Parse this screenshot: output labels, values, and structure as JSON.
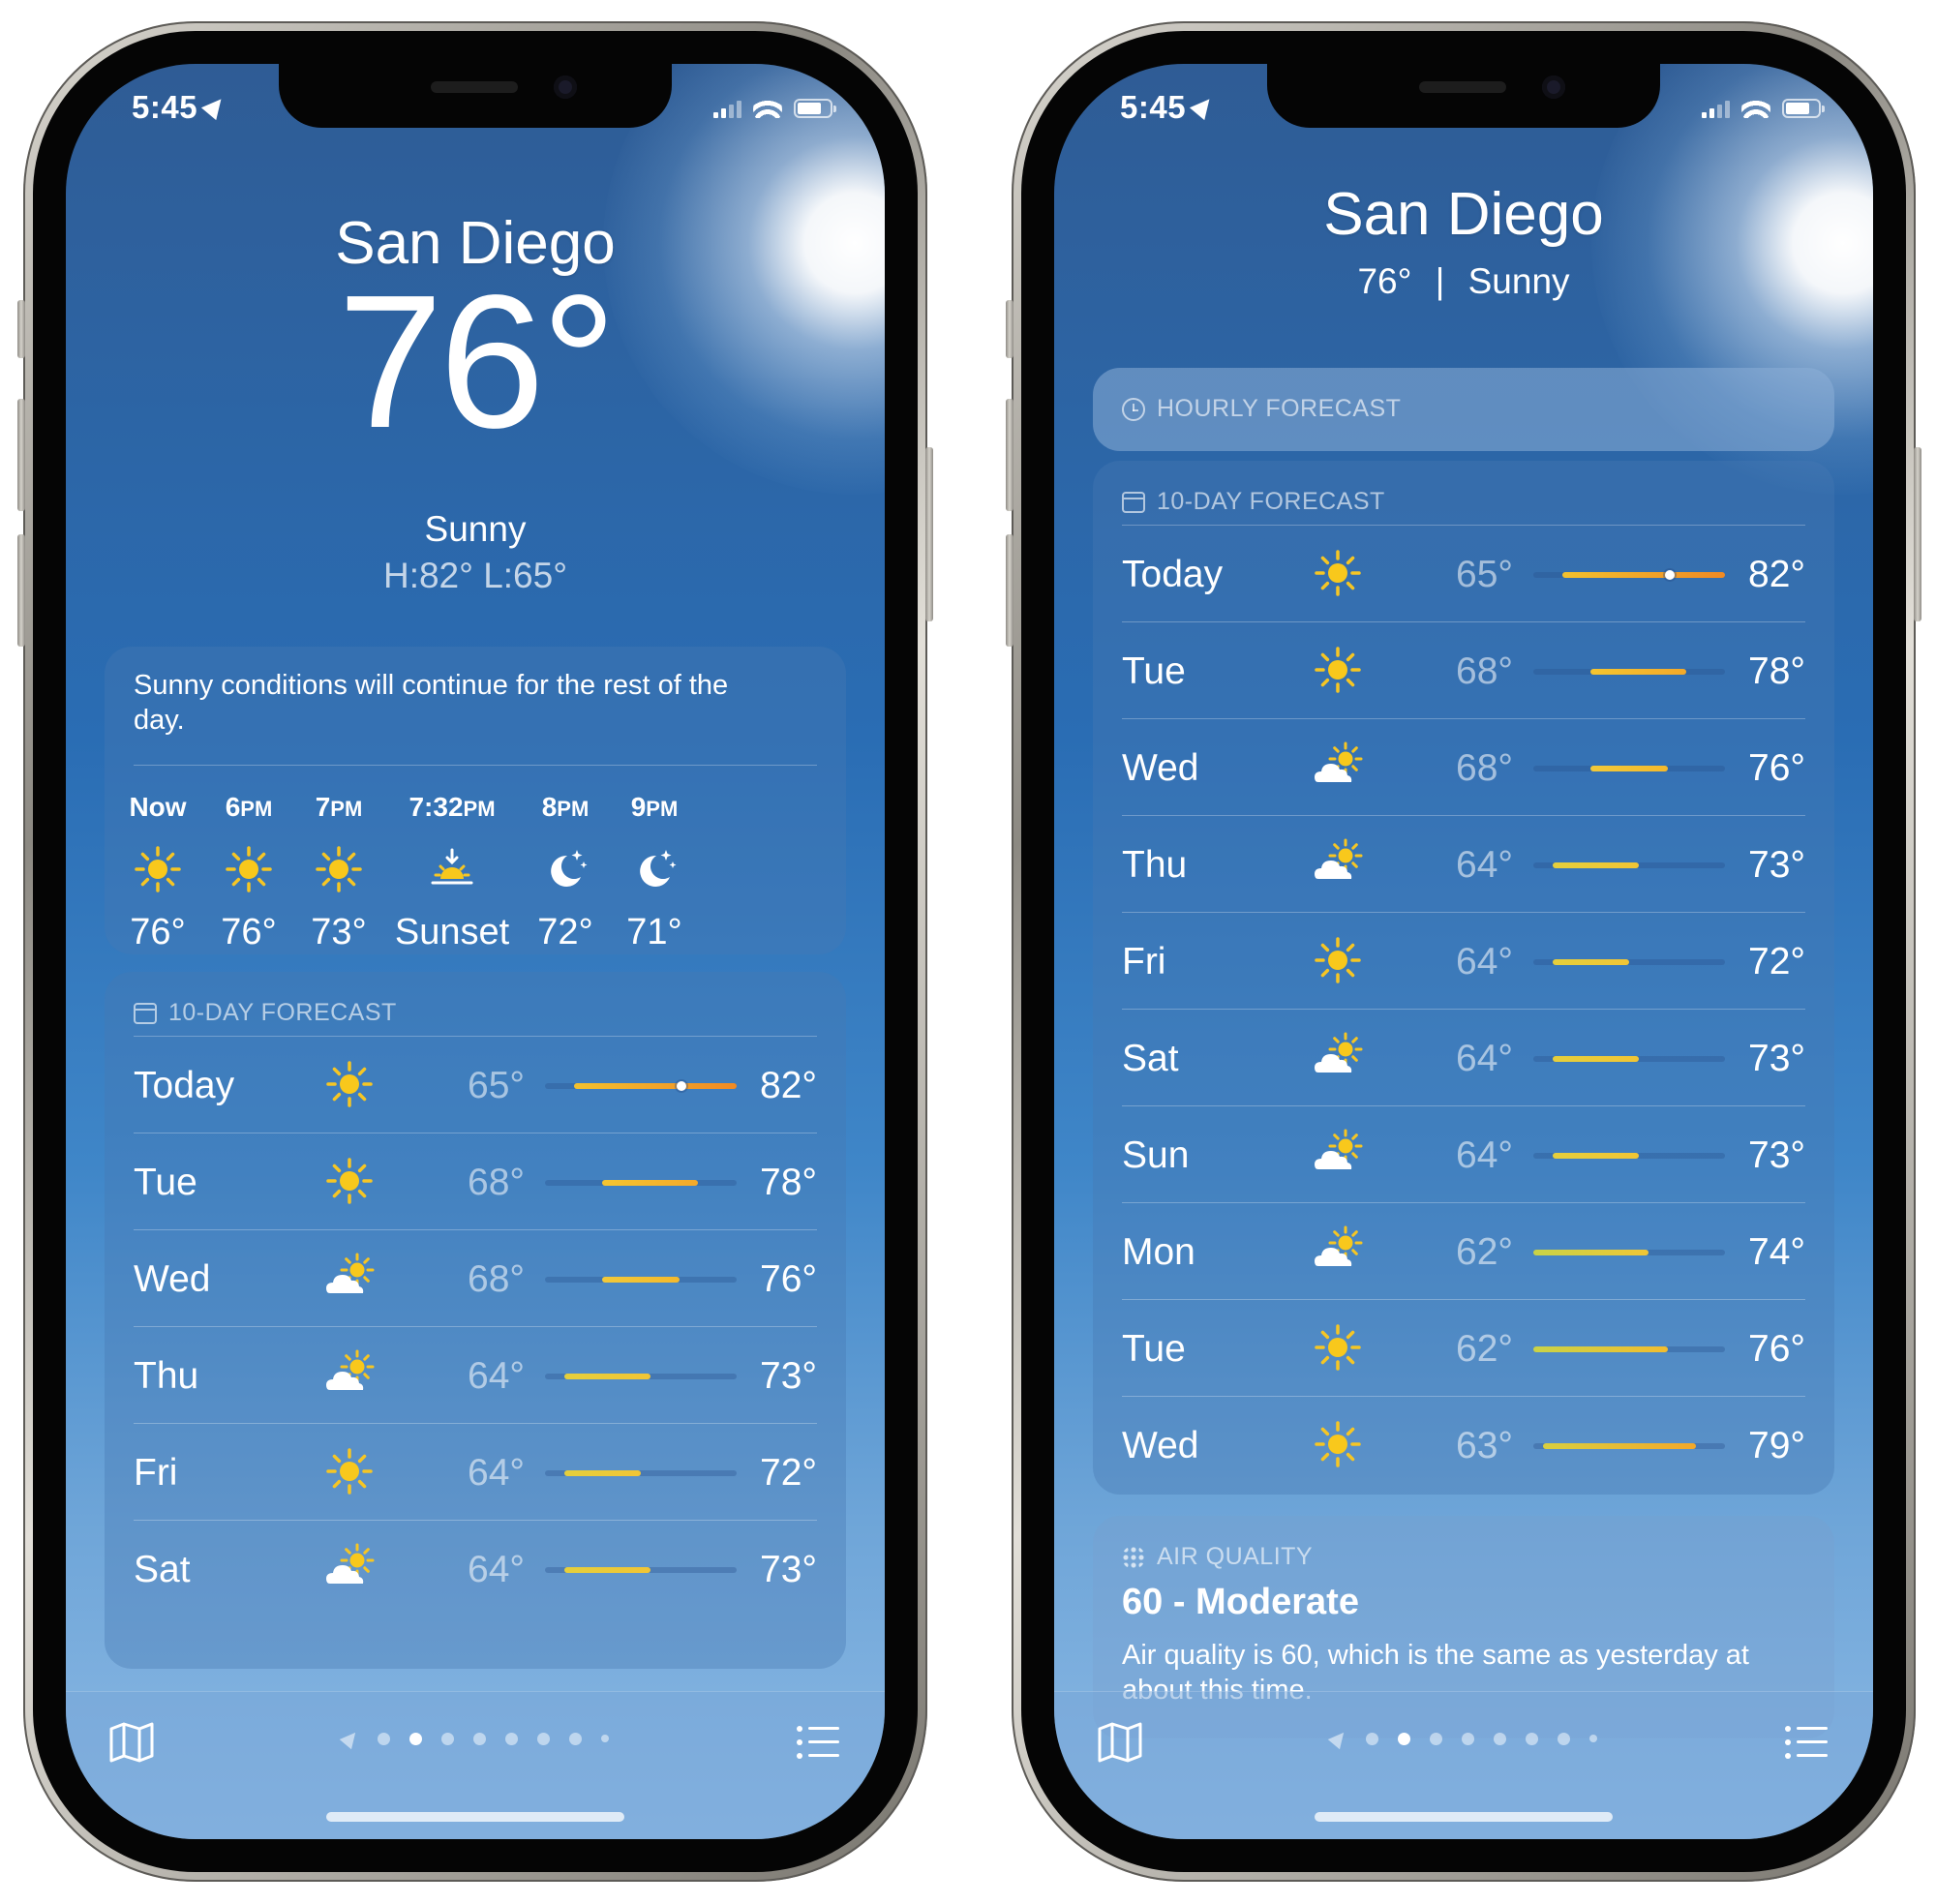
{
  "status": {
    "time": "5:45"
  },
  "left": {
    "city": "San Diego",
    "temperature": "76°",
    "condition": "Sunny",
    "hilo": "H:82°  L:65°",
    "summary": "Sunny conditions will continue for the rest of the day.",
    "hourly": [
      {
        "label": "Now",
        "suffix": "",
        "icon": "sun-icon",
        "temp": "76°"
      },
      {
        "label": "6",
        "suffix": "PM",
        "icon": "sun-icon",
        "temp": "76°"
      },
      {
        "label": "7",
        "suffix": "PM",
        "icon": "sun-icon",
        "temp": "73°"
      },
      {
        "label": "7:32",
        "suffix": "PM",
        "icon": "sunset-icon",
        "temp": "Sunset"
      },
      {
        "label": "8",
        "suffix": "PM",
        "icon": "moon-stars-icon",
        "temp": "72°"
      },
      {
        "label": "9",
        "suffix": "PM",
        "icon": "moon-stars-icon",
        "temp": "71°"
      }
    ],
    "forecast_title": "10-DAY FORECAST"
  },
  "right": {
    "city": "San Diego",
    "temperature": "76°",
    "separator": "|",
    "condition": "Sunny",
    "hourly_title": "HOURLY FORECAST",
    "forecast_title": "10-DAY FORECAST",
    "aq_title": "AIR QUALITY",
    "aq_value": "60 - Moderate",
    "aq_desc": "Air quality is 60, which is the same as yesterday at about this time."
  },
  "forecast": [
    {
      "day": "Today",
      "icon": "sun-icon",
      "low": "65°",
      "high": "82°",
      "bar_start": 0.15,
      "bar_end": 1.0,
      "current": 0.71,
      "color_a": "#f2c12e",
      "color_b": "#f08a24"
    },
    {
      "day": "Tue",
      "icon": "sun-icon",
      "low": "68°",
      "high": "78°",
      "bar_start": 0.3,
      "bar_end": 0.8,
      "color_a": "#f5c530",
      "color_b": "#f3a92a"
    },
    {
      "day": "Wed",
      "icon": "cloud-sun-icon",
      "low": "68°",
      "high": "76°",
      "bar_start": 0.3,
      "bar_end": 0.7,
      "color_a": "#f1c93a",
      "color_b": "#f4b92c"
    },
    {
      "day": "Thu",
      "icon": "cloud-sun-icon",
      "low": "64°",
      "high": "73°",
      "bar_start": 0.1,
      "bar_end": 0.55,
      "color_a": "#e5cf3c",
      "color_b": "#f1c535"
    },
    {
      "day": "Fri",
      "icon": "sun-icon",
      "low": "64°",
      "high": "72°",
      "bar_start": 0.1,
      "bar_end": 0.5,
      "color_a": "#e5cf3c",
      "color_b": "#f1c535"
    },
    {
      "day": "Sat",
      "icon": "cloud-sun-icon",
      "low": "64°",
      "high": "73°",
      "bar_start": 0.1,
      "bar_end": 0.55,
      "color_a": "#e5cf3c",
      "color_b": "#f1c535"
    },
    {
      "day": "Sun",
      "icon": "cloud-sun-icon",
      "low": "64°",
      "high": "73°",
      "bar_start": 0.1,
      "bar_end": 0.55,
      "color_a": "#e5cf3c",
      "color_b": "#f1c535"
    },
    {
      "day": "Mon",
      "icon": "cloud-sun-icon",
      "low": "62°",
      "high": "74°",
      "bar_start": 0.0,
      "bar_end": 0.6,
      "color_a": "#c9d347",
      "color_b": "#efc636"
    },
    {
      "day": "Tue",
      "icon": "sun-icon",
      "low": "62°",
      "high": "76°",
      "bar_start": 0.0,
      "bar_end": 0.7,
      "color_a": "#c9d347",
      "color_b": "#f2bd2f"
    },
    {
      "day": "Wed",
      "icon": "sun-icon",
      "low": "63°",
      "high": "79°",
      "bar_start": 0.05,
      "bar_end": 0.85,
      "color_a": "#d9cf40",
      "color_b": "#f3a82a"
    }
  ],
  "pager": {
    "pages": 9,
    "active": 1
  }
}
